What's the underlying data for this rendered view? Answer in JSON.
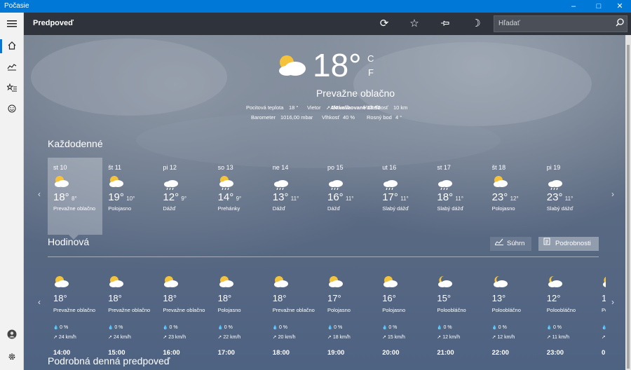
{
  "window": {
    "title": "Počasie"
  },
  "app": {
    "name": "Predpoveď",
    "search_placeholder": "Hľadať"
  },
  "current": {
    "temp": "18°",
    "unit_c": "C",
    "unit_f": "F",
    "condition": "Prevažne oblačno",
    "updated": "Aktualizované 13:52",
    "feels_label": "Pocitová teplota",
    "feels": "18 °",
    "wind_label": "Vietor",
    "wind": "➚ 24 km/h",
    "visibility_label": "Viditeľnosť",
    "visibility": "10 km",
    "barometer_label": "Barometer",
    "barometer": "1016,00 mbar",
    "humidity_label": "Vlhkosť",
    "humidity": "40 %",
    "dew_label": "Rosný bod",
    "dew": "4 °"
  },
  "daily": {
    "title": "Každodenné",
    "days": [
      {
        "name": "st 10",
        "hi": "18°",
        "lo": "8°",
        "cond": "Prevažne oblačno",
        "icon": "partly-cloudy-icon"
      },
      {
        "name": "št 11",
        "hi": "19°",
        "lo": "10°",
        "cond": "Polojasno",
        "icon": "partly-sunny-icon"
      },
      {
        "name": "pi 12",
        "hi": "12°",
        "lo": "9°",
        "cond": "Dážď",
        "icon": "rain-icon"
      },
      {
        "name": "so 13",
        "hi": "14°",
        "lo": "9°",
        "cond": "Prehánky",
        "icon": "showers-icon"
      },
      {
        "name": "ne 14",
        "hi": "13°",
        "lo": "11°",
        "cond": "Dážď",
        "icon": "rain-icon"
      },
      {
        "name": "po 15",
        "hi": "16°",
        "lo": "11°",
        "cond": "Dážď",
        "icon": "rain-icon"
      },
      {
        "name": "ut 16",
        "hi": "17°",
        "lo": "11°",
        "cond": "Slabý dážď",
        "icon": "light-rain-icon"
      },
      {
        "name": "st 17",
        "hi": "18°",
        "lo": "11°",
        "cond": "Slabý dážď",
        "icon": "light-rain-icon"
      },
      {
        "name": "št 18",
        "hi": "23°",
        "lo": "12°",
        "cond": "Polojasno",
        "icon": "partly-sunny-icon"
      },
      {
        "name": "pi 19",
        "hi": "23°",
        "lo": "11°",
        "cond": "Slabý dážď",
        "icon": "light-rain-icon"
      }
    ]
  },
  "hourly": {
    "title": "Hodinová",
    "summary_label": "Súhrn",
    "details_label": "Podrobnosti",
    "hours": [
      {
        "time": "14:00",
        "temp": "18°",
        "cond": "Prevažne oblačno",
        "precip": "0 %",
        "wind": "24 km/h",
        "night": false
      },
      {
        "time": "15:00",
        "temp": "18°",
        "cond": "Prevažne oblačno",
        "precip": "0 %",
        "wind": "24 km/h",
        "night": false
      },
      {
        "time": "16:00",
        "temp": "18°",
        "cond": "Prevažne oblačno",
        "precip": "0 %",
        "wind": "23 km/h",
        "night": false
      },
      {
        "time": "17:00",
        "temp": "18°",
        "cond": "Polojasno",
        "precip": "0 %",
        "wind": "22 km/h",
        "night": false
      },
      {
        "time": "18:00",
        "temp": "18°",
        "cond": "Prevažne oblačno",
        "precip": "0 %",
        "wind": "20 km/h",
        "night": false
      },
      {
        "time": "19:00",
        "temp": "17°",
        "cond": "Polojasno",
        "precip": "0 %",
        "wind": "18 km/h",
        "night": false
      },
      {
        "time": "20:00",
        "temp": "16°",
        "cond": "Polojasno",
        "precip": "0 %",
        "wind": "15 km/h",
        "night": false
      },
      {
        "time": "21:00",
        "temp": "15°",
        "cond": "Poloobláčno",
        "precip": "0 %",
        "wind": "12 km/h",
        "night": true
      },
      {
        "time": "22:00",
        "temp": "13°",
        "cond": "Poloobláčno",
        "precip": "0 %",
        "wind": "12 km/h",
        "night": true
      },
      {
        "time": "23:00",
        "temp": "12°",
        "cond": "Poloobláčno",
        "precip": "0 %",
        "wind": "11 km/h",
        "night": true
      },
      {
        "time": "0:",
        "temp": "1",
        "cond": "Po",
        "precip": "",
        "wind": "",
        "night": true
      }
    ]
  },
  "detail": {
    "title": "Podrobná denná predpoveď"
  }
}
